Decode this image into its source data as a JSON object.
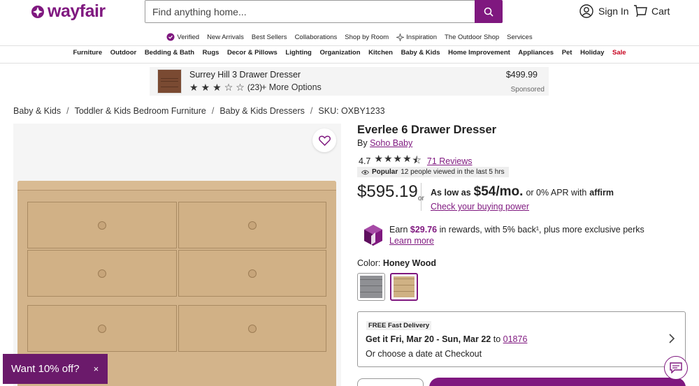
{
  "header": {
    "brand": "wayfair",
    "search_placeholder": "Find anything home...",
    "signin_label": "Sign In",
    "cart_label": "Cart"
  },
  "subnav": [
    {
      "label": "Verified",
      "icon": "verified-badge-icon"
    },
    {
      "label": "New Arrivals"
    },
    {
      "label": "Best Sellers"
    },
    {
      "label": "Collaborations"
    },
    {
      "label": "Shop by Room"
    },
    {
      "label": "Inspiration",
      "icon": "sparkle-icon"
    },
    {
      "label": "The Outdoor Shop"
    },
    {
      "label": "Services"
    }
  ],
  "mainnav": [
    "Furniture",
    "Outdoor",
    "Bedding & Bath",
    "Rugs",
    "Decor & Pillows",
    "Lighting",
    "Organization",
    "Kitchen",
    "Baby & Kids",
    "Home Improvement",
    "Appliances",
    "Pet",
    "Holiday",
    "Sale"
  ],
  "banner": {
    "title": "Surrey Hill 3 Drawer Dresser",
    "rating": 3,
    "review_count": "(23)",
    "more_options": "+ More Options",
    "price": "$499.99",
    "sponsored": "Sponsored"
  },
  "breadcrumb": [
    "Baby & Kids",
    "Toddler & Kids Bedroom Furniture",
    "Baby & Kids Dressers",
    "SKU: OXBY1233"
  ],
  "product": {
    "title": "Everlee 6 Drawer Dresser",
    "by_prefix": "By",
    "brand": "Soho Baby",
    "rating_value": "4.7",
    "rating_stars": 4.5,
    "reviews": "71 Reviews",
    "popular_label": "Popular",
    "popular_text": "12 people viewed in the last 5 hrs",
    "price": "$595.19",
    "or": "or",
    "as_low_as": "As low as",
    "monthly": "$54/mo.",
    "apr_text": "or 0% APR with",
    "affirm": "affirm",
    "check_power": "Check your buying power",
    "rewards_prefix": "Earn",
    "rewards_amount": "$29.76",
    "rewards_text": "in rewards, with 5% back¹, plus more exclusive perks",
    "learn_more": "Learn more",
    "color_label": "Color:",
    "color_value": "Honey Wood",
    "swatches": [
      {
        "name": "Gray",
        "color": "#8f9094"
      },
      {
        "name": "Honey Wood",
        "color": "#cfb184",
        "selected": true
      }
    ]
  },
  "delivery": {
    "badge": "FREE Fast Delivery",
    "line_prefix": "Get it",
    "dates": "Fri, Mar 20 - Sun, Mar 22",
    "to": "to",
    "zip": "01876",
    "line2": "Or choose a date at Checkout"
  },
  "promo": {
    "text": "Want 10% off?",
    "close": "×"
  },
  "colors": {
    "brand_purple": "#7f187f",
    "sale_red": "#c7001e"
  }
}
